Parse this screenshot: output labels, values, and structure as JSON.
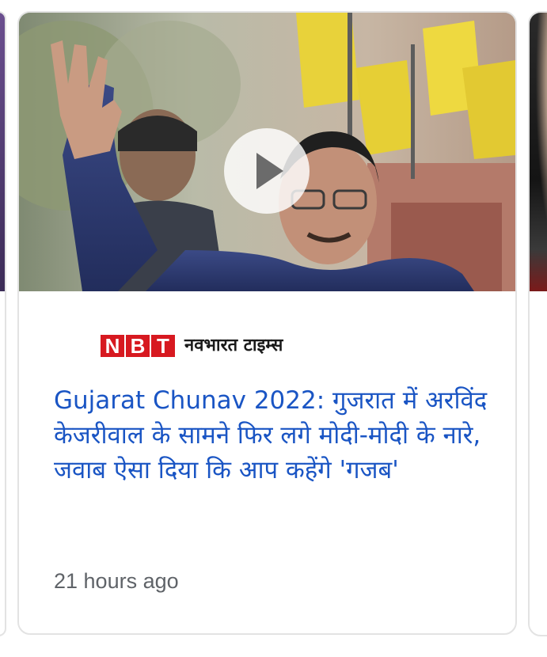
{
  "article": {
    "source": {
      "logo_letters": [
        "N",
        "B",
        "T"
      ],
      "name": "नवभारत टाइम्स"
    },
    "headline": "Gujarat Chunav 2022: गुजरात में अरविंद केजरीवाल के सामने फिर लगे मोदी-मोदी के नारे, जवाब ऐसा दिया कि आप कहेंगे 'गजब'",
    "timestamp": "21 hours ago",
    "media_type": "video",
    "play_icon": "play-icon"
  },
  "colors": {
    "headline": "#1a55c4",
    "logo_red": "#d71920",
    "timestamp": "#5f6368",
    "card_border": "#e3e3e3"
  }
}
